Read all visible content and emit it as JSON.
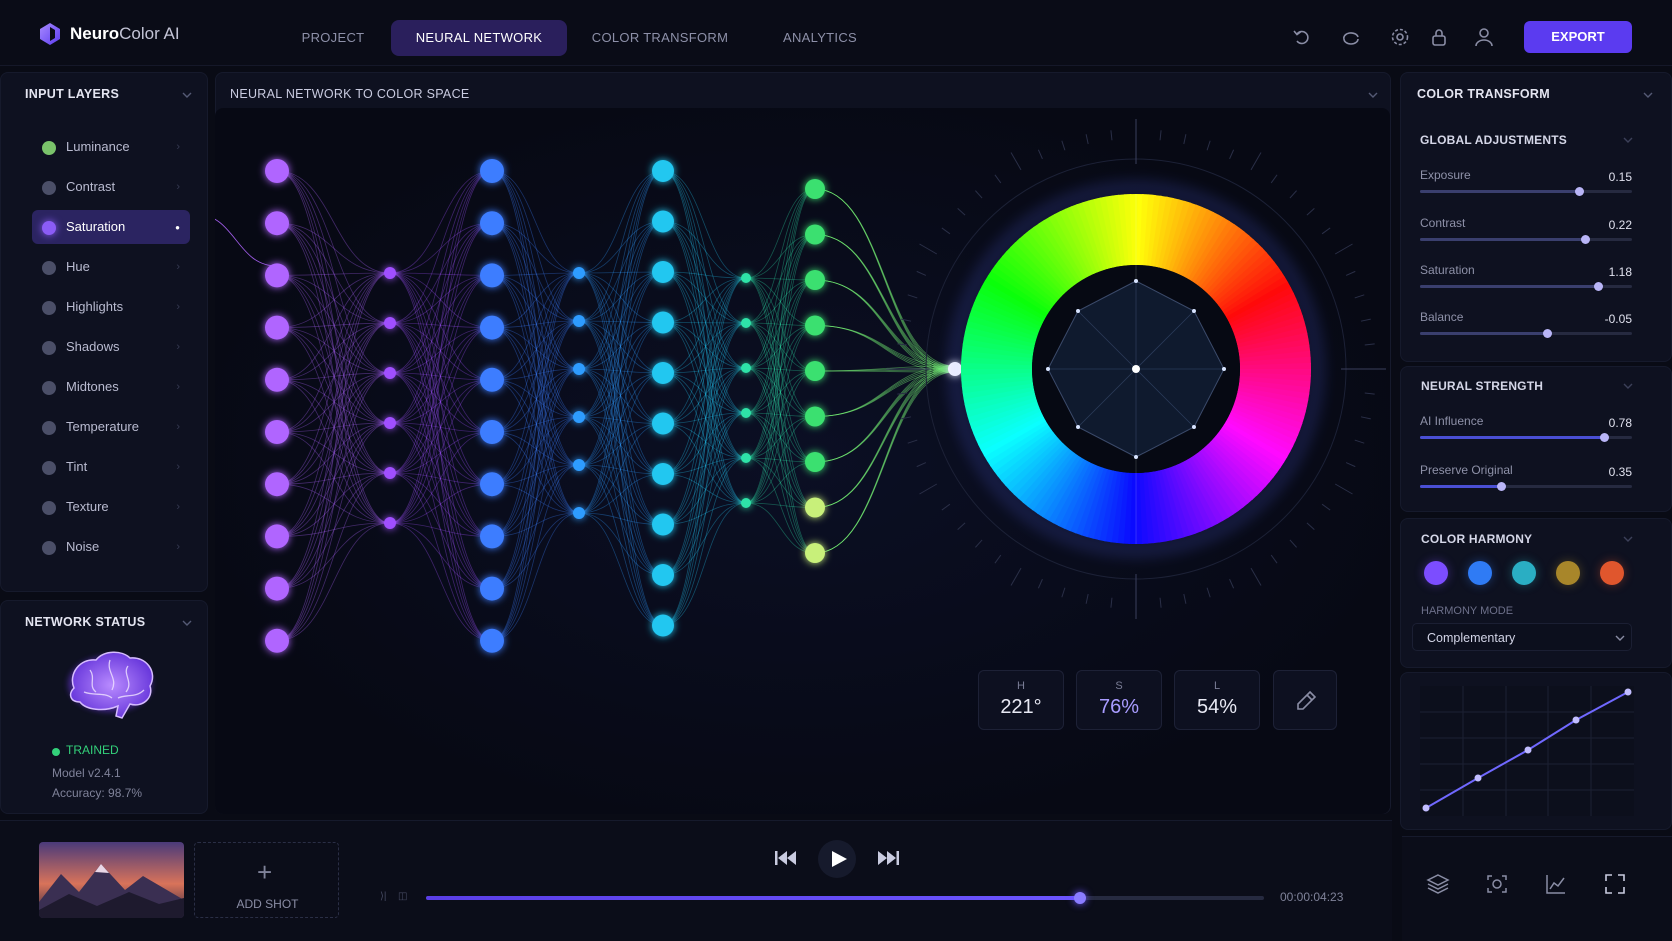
{
  "app": {
    "name_bold": "Neuro",
    "name_light": "Color AI"
  },
  "nav": {
    "tabs": [
      "PROJECT",
      "NEURAL NETWORK",
      "COLOR TRANSFORM",
      "ANALYTICS"
    ],
    "active_tab": "NEURAL NETWORK",
    "export_label": "EXPORT",
    "icons": [
      "undo-icon",
      "redo-icon",
      "settings-icon",
      "lock-icon",
      "user-icon"
    ]
  },
  "input_layers": {
    "title": "INPUT LAYERS",
    "items": [
      {
        "label": "Luminance",
        "color": "#7ac36b"
      },
      {
        "label": "Contrast",
        "color": "#4b4f68"
      },
      {
        "label": "Saturation",
        "color": "#8b5cf6",
        "active": true
      },
      {
        "label": "Hue",
        "color": "#4b4f68"
      },
      {
        "label": "Highlights",
        "color": "#4b4f68"
      },
      {
        "label": "Shadows",
        "color": "#4b4f68"
      },
      {
        "label": "Midtones",
        "color": "#4b4f68"
      },
      {
        "label": "Temperature",
        "color": "#4b4f68"
      },
      {
        "label": "Tint",
        "color": "#4b4f68"
      },
      {
        "label": "Texture",
        "color": "#4b4f68"
      },
      {
        "label": "Noise",
        "color": "#4b4f68"
      }
    ]
  },
  "network_status": {
    "title": "NETWORK STATUS",
    "state": "TRAINED",
    "model": "Model v2.4.1",
    "accuracy": "Accuracy: 98.7%"
  },
  "canvas": {
    "title": "NEURAL NETWORK TO COLOR SPACE",
    "hsl": {
      "h_label": "H",
      "h_value": "221°",
      "s_label": "S",
      "s_value": "76%",
      "l_label": "L",
      "l_value": "54%"
    }
  },
  "color_transform": {
    "title": "COLOR TRANSFORM",
    "global": {
      "title": "GLOBAL ADJUSTMENTS",
      "items": [
        {
          "label": "Exposure",
          "value": "0.15",
          "level": 0.75
        },
        {
          "label": "Contrast",
          "value": "0.22",
          "level": 0.78
        },
        {
          "label": "Saturation",
          "value": "1.18",
          "level": 0.84
        },
        {
          "label": "Balance",
          "value": "-0.05",
          "level": 0.6
        }
      ]
    },
    "neural": {
      "title": "NEURAL STRENGTH",
      "items": [
        {
          "label": "AI Influence",
          "value": "0.78",
          "level": 0.87
        },
        {
          "label": "Preserve Original",
          "value": "0.35",
          "level": 0.38
        }
      ]
    },
    "harmony": {
      "title": "COLOR HARMONY",
      "swatches": [
        "#7c4dff",
        "#2f7bf5",
        "#2aaec3",
        "#a8862a",
        "#e0562d"
      ],
      "mode_label": "HARMONY MODE",
      "mode_value": "Complementary"
    }
  },
  "playback": {
    "add_shot_label": "ADD SHOT",
    "timecode": "00:00:04:23",
    "progress": 0.78
  }
}
